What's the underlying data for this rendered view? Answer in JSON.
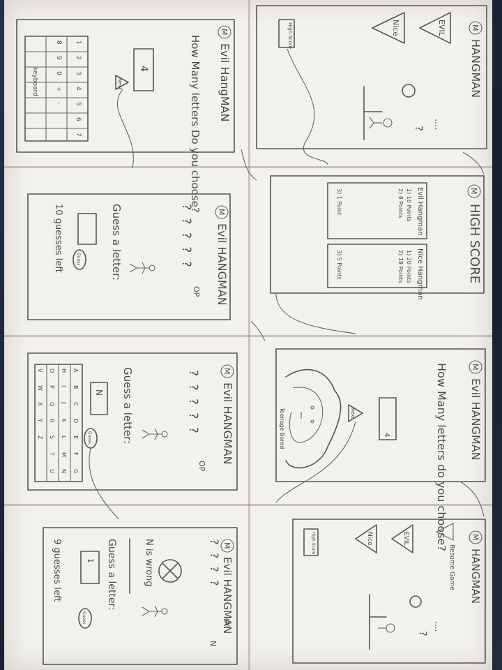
{
  "sheet": {
    "frame1": {
      "logo": "M",
      "title": "Evil HangMAN",
      "question": "How Many letters Do you choose?",
      "input_value": "4",
      "next_button": "Next",
      "keys": [
        "1",
        "2",
        "3",
        "4",
        "5",
        "6",
        "7",
        "8",
        "9",
        "0",
        "+",
        "-"
      ],
      "keyboard_label": "keyboard"
    },
    "frame2": {
      "logo": "M",
      "title": "HANGMAN",
      "evil_button": "EVIL",
      "nice_button": "Nice",
      "highscore_button": "High Score",
      "word_dots": "....",
      "mark": "?"
    },
    "frame3": {
      "logo": "M",
      "title": "Evil HANGMAN",
      "blanks": "? ? ? ? ?",
      "op_label": "OP",
      "prompt": "Guess a letter:",
      "guess_button": "Guess",
      "guesses_left": "10 guesses left"
    },
    "frame4": {
      "logo": "M",
      "title": "HIGH SCORE",
      "evil_header": "Evil Hangman",
      "evil_scores": [
        "1) 10 Points",
        "2) 8 Points",
        "3) 1 Point"
      ],
      "nice_header": "Nice Hangman",
      "nice_scores": [
        "1) 20 Points",
        "2) 18 Points",
        "3) 5 Points"
      ]
    },
    "frame5": {
      "logo": "M",
      "title": "Evil HANGMAN",
      "blanks": "? ? ? ? ?",
      "op_label": "OP",
      "prompt": "Guess a letter:",
      "input_value": "N",
      "guess_button": "Guess",
      "letters": [
        "A",
        "B",
        "C",
        "D",
        "E",
        "F",
        "G",
        "H",
        "I",
        "J",
        "K",
        "L",
        "M",
        "N",
        "O",
        "P",
        "Q",
        "R",
        "S",
        "T",
        "U",
        "V",
        "W",
        "X",
        "Y",
        "Z"
      ]
    },
    "frame6": {
      "logo": "M",
      "title": "Evil HANGMAN",
      "question": "How Many letters do you choose?",
      "input_value": "4",
      "next_button": "Next",
      "caption": "Teenage Bored"
    },
    "frame7": {
      "logo": "M",
      "title": "Evil HANGMAN",
      "blanks": "? ? ? ?",
      "op_label": "OP",
      "wrong_letter": "N",
      "wrong_message": "N is wrong",
      "prompt": "Guess a letter:",
      "input_value": "1",
      "guess_button": "Guess",
      "guesses_left": "9 guesses left"
    },
    "frame8": {
      "logo": "M",
      "title": "HANGMAN",
      "resume_button": "Resume Game",
      "evil_button": "EVIL",
      "nice_button": "Nice",
      "highscore_button": "High Score",
      "word_dots": "....",
      "mark": "?"
    }
  }
}
